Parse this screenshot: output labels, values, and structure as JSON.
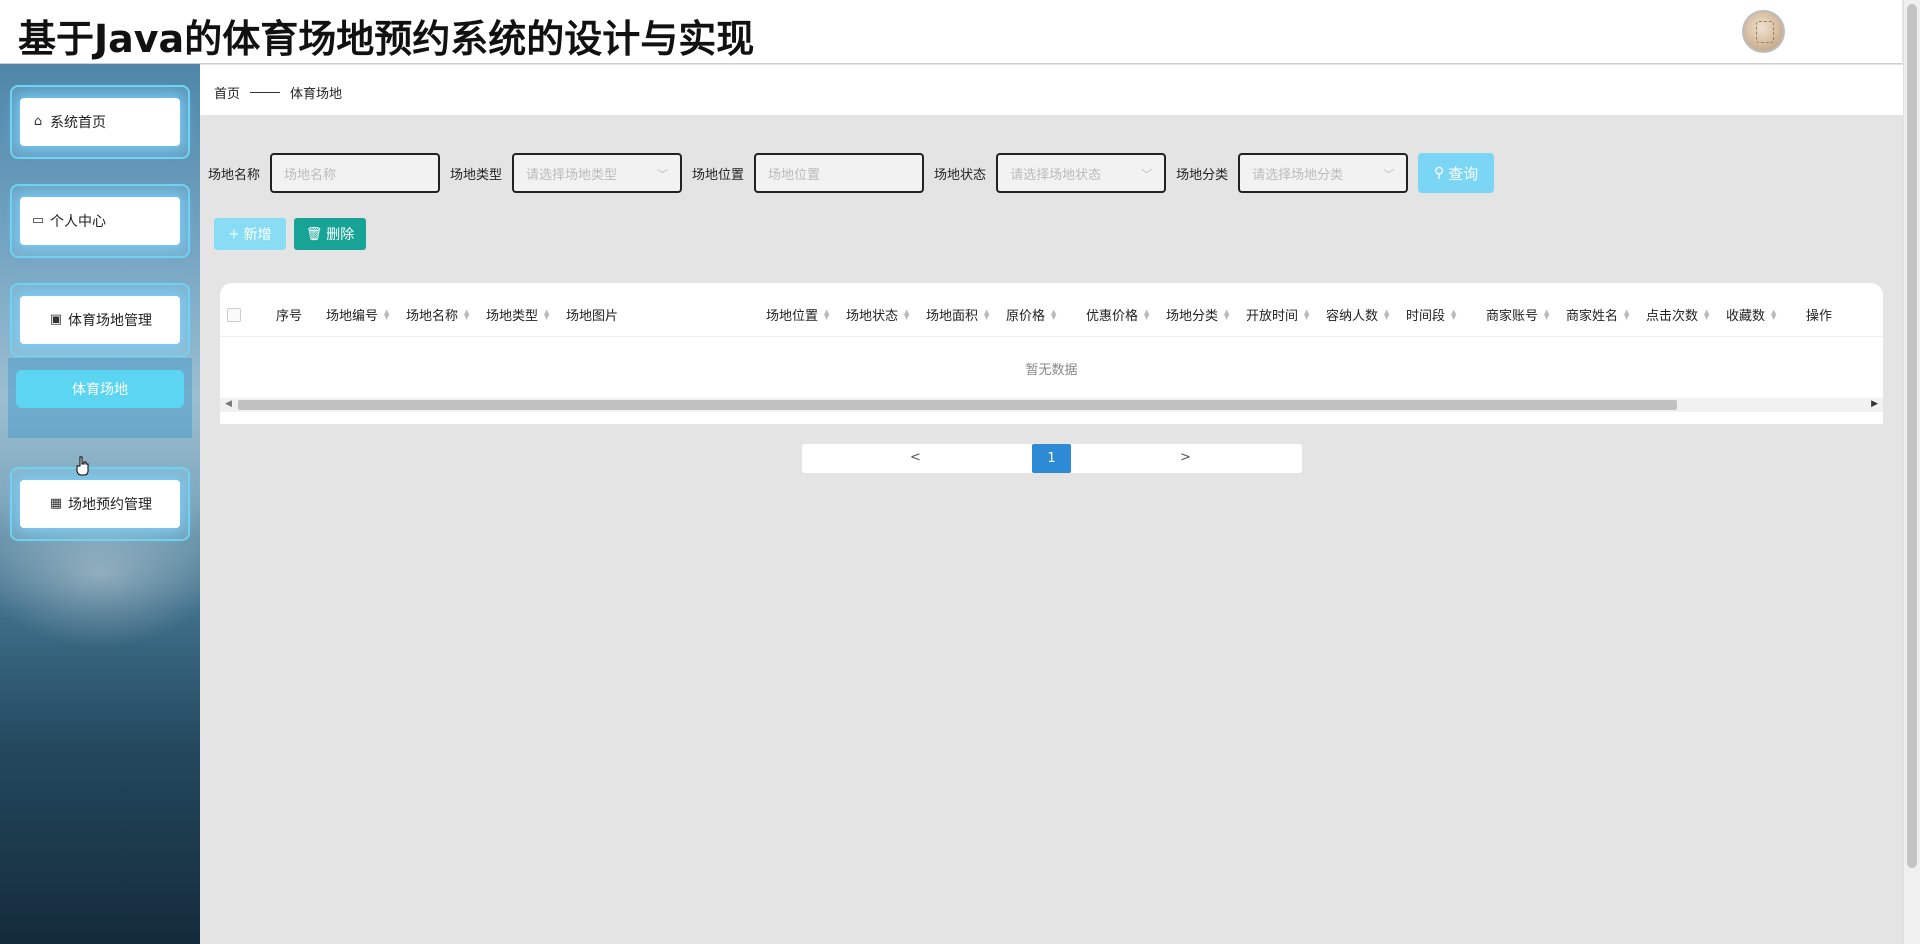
{
  "app": {
    "title": "基于Java的体育场地预约系统的设计与实现"
  },
  "sidebar": {
    "items": [
      {
        "label": "系统首页",
        "icon": "home-icon"
      },
      {
        "label": "个人中心",
        "icon": "card-icon"
      },
      {
        "label": "体育场地管理",
        "icon": "clipboard-icon"
      },
      {
        "label": "场地预约管理",
        "icon": "grid-icon"
      }
    ],
    "submenu": {
      "label": "体育场地"
    }
  },
  "breadcrumb": {
    "home": "首页",
    "current": "体育场地"
  },
  "filters": [
    {
      "label": "场地名称",
      "placeholder": "场地名称",
      "type": "input"
    },
    {
      "label": "场地类型",
      "placeholder": "请选择场地类型",
      "type": "select"
    },
    {
      "label": "场地位置",
      "placeholder": "场地位置",
      "type": "input"
    },
    {
      "label": "场地状态",
      "placeholder": "请选择场地状态",
      "type": "select"
    },
    {
      "label": "场地分类",
      "placeholder": "请选择场地分类",
      "type": "select"
    }
  ],
  "search_button": "查询",
  "actions": {
    "add": "新增",
    "delete": "删除"
  },
  "table": {
    "columns": [
      {
        "label": "序号",
        "sortable": false
      },
      {
        "label": "场地编号",
        "sortable": true
      },
      {
        "label": "场地名称",
        "sortable": true
      },
      {
        "label": "场地类型",
        "sortable": true
      },
      {
        "label": "场地图片",
        "sortable": false
      },
      {
        "label": "场地位置",
        "sortable": true
      },
      {
        "label": "场地状态",
        "sortable": true
      },
      {
        "label": "场地面积",
        "sortable": true
      },
      {
        "label": "原价格",
        "sortable": true
      },
      {
        "label": "优惠价格",
        "sortable": true
      },
      {
        "label": "场地分类",
        "sortable": true
      },
      {
        "label": "开放时间",
        "sortable": true
      },
      {
        "label": "容纳人数",
        "sortable": true
      },
      {
        "label": "时间段",
        "sortable": true
      },
      {
        "label": "商家账号",
        "sortable": true
      },
      {
        "label": "商家姓名",
        "sortable": true
      },
      {
        "label": "点击次数",
        "sortable": true
      },
      {
        "label": "收藏数",
        "sortable": true
      },
      {
        "label": "操作",
        "sortable": false
      }
    ],
    "empty_text": "暂无数据"
  },
  "pagination": {
    "prev": "<",
    "current": "1",
    "next": ">"
  },
  "colors": {
    "accent": "#5cd5f2",
    "primary": "#2c8bd4",
    "danger_teal": "#17a396"
  }
}
